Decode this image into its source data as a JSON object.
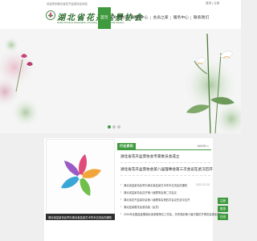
{
  "topbar": {
    "welcome": "欢迎来到湖北省花卉盆景协会网站",
    "login": "登录",
    "register": "注册"
  },
  "header": {
    "logo_title": "湖北省花卉盆景协会",
    "logo_subtitle": "Hubei Province Association of Potting and Ornamental Flowers"
  },
  "nav": {
    "items": [
      {
        "label": "首页",
        "active": true
      },
      {
        "label": "关于我们",
        "active": false
      },
      {
        "label": "新闻中心",
        "active": false
      },
      {
        "label": "会员之家",
        "active": false
      },
      {
        "label": "服务中心",
        "active": false
      },
      {
        "label": "联系我们",
        "active": false
      }
    ]
  },
  "banner": {
    "dots": 3,
    "active_dot": 0
  },
  "slideshow": {
    "caption": "湖北省盆景协会举办湖北省盆景艺术学术交流会的通知"
  },
  "news": {
    "tab_label": "行业资讯",
    "more": "MORE>>",
    "headlines": [
      "湖北省花卉盆景协会专家委员会成立",
      "湖北省花卉盆景协会第八届理事会第三次会议在武汉召开"
    ],
    "items": [
      {
        "text": "湖北省盆景协会举办湖北省盆景艺术学术交流会的通知",
        "date": "2021-02-20"
      },
      {
        "text": "湖北省盆景协会召开第八届理事会第二次会议",
        "date": ""
      },
      {
        "text": "湖北省花卉盆景协会第八届理事会第四次会议在武汉召开",
        "date": ""
      },
      {
        "text": "湖北盆景展览会邀请函（会员）",
        "date": ""
      },
      {
        "text": "2016年全国盆景展湖北省参展单位工作会，共同谋划第十届中国花卉博览会湖北展区",
        "date": ""
      }
    ]
  },
  "side_widget": {
    "buttons": [
      "注册",
      "登录",
      "在线"
    ]
  },
  "colors": {
    "accent_green": "#3f9a3f",
    "logo_green": "#2a6b2a",
    "banner_bg": "#f4f5f4"
  }
}
